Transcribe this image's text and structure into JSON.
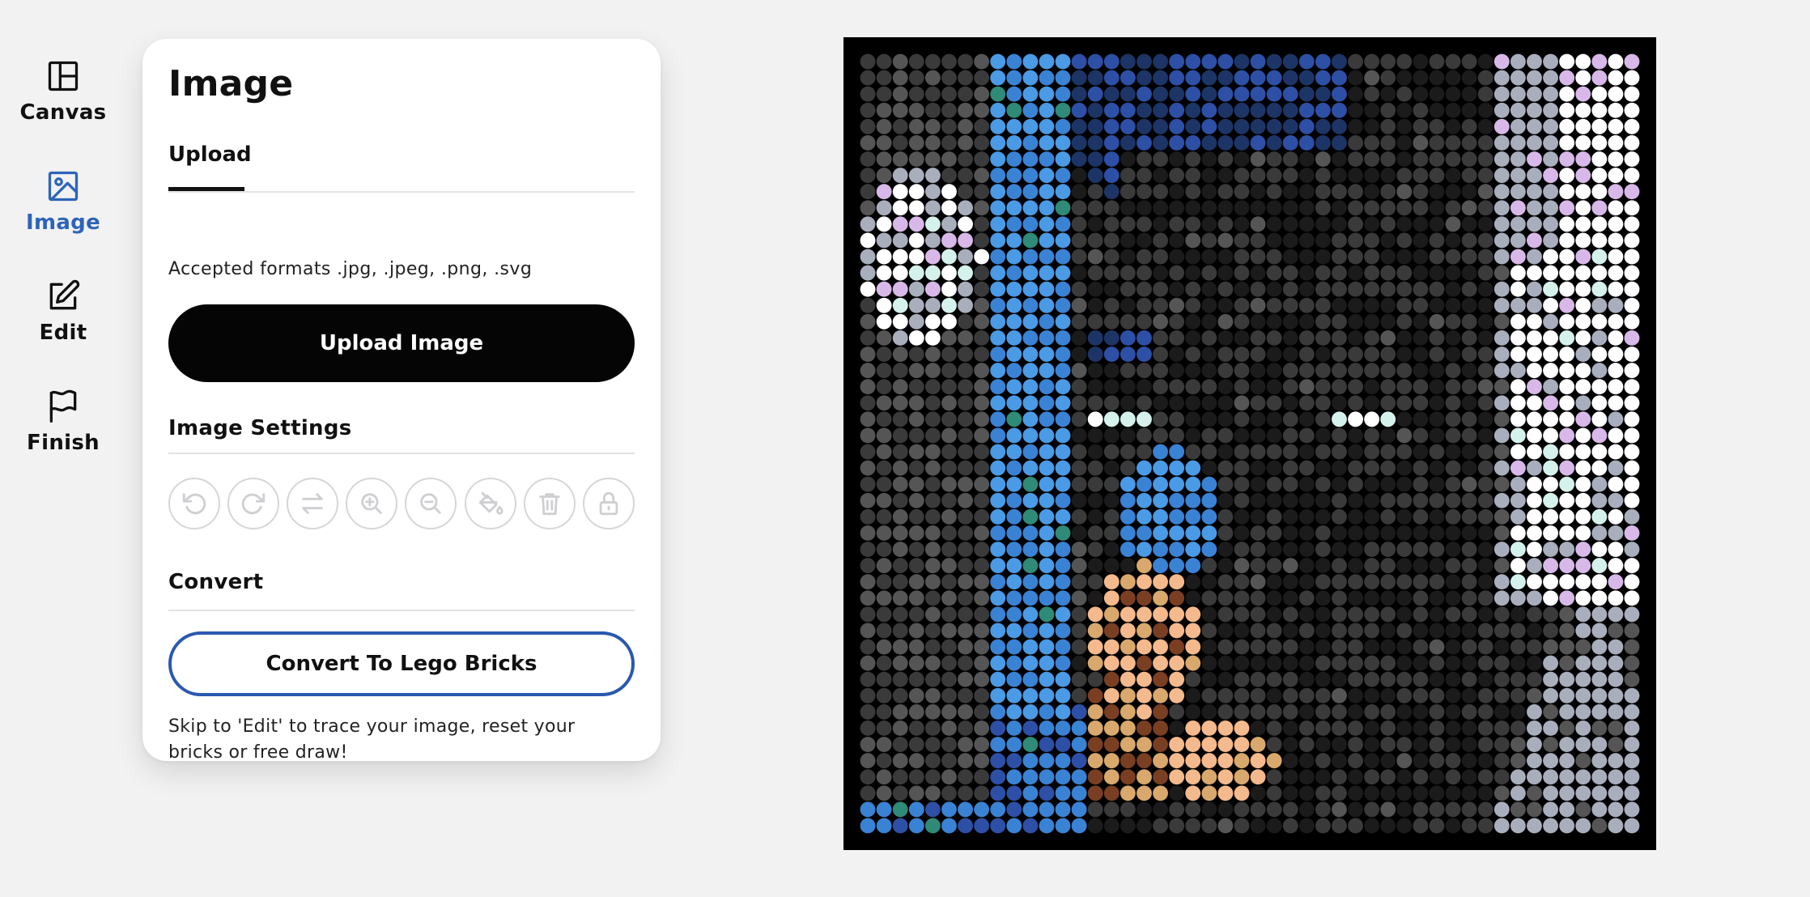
{
  "nav": {
    "items": [
      {
        "label": "Canvas",
        "icon": "layout-icon",
        "active": false
      },
      {
        "label": "Image",
        "icon": "image-icon",
        "active": true
      },
      {
        "label": "Edit",
        "icon": "edit-icon",
        "active": false
      },
      {
        "label": "Finish",
        "icon": "flag-icon",
        "active": false
      }
    ],
    "active_color": "#2e64b8"
  },
  "panel": {
    "title": "Image",
    "tab": "Upload",
    "formats": "Accepted formats .jpg, .jpeg, .png, .svg",
    "upload_button": "Upload Image",
    "settings_title": "Image Settings",
    "tools": [
      {
        "name": "rotate-left-icon"
      },
      {
        "name": "rotate-right-icon"
      },
      {
        "name": "flip-icon"
      },
      {
        "name": "zoom-in-icon"
      },
      {
        "name": "zoom-out-icon"
      },
      {
        "name": "paint-bucket-icon"
      },
      {
        "name": "trash-icon"
      },
      {
        "name": "lock-icon"
      }
    ],
    "convert_title": "Convert",
    "convert_button": "Convert To Lego Bricks",
    "hint": "Skip to 'Edit' to trace your image, reset your bricks or free draw!",
    "convert_border_color": "#2a58b0"
  },
  "canvas": {
    "grid_size": 48,
    "palette": {
      "dark": "#3a3a3a",
      "gray": "#555555",
      "black_stud": "#1b1b1b",
      "blue": "#3a82d4",
      "light_blue": "#4a9ae6",
      "royal_blue": "#2d4fa6",
      "navy": "#1c3566",
      "white": "#ffffff",
      "silver": "#a9aebd",
      "lavender": "#d8b8e8",
      "mint": "#d5f1ec",
      "peach": "#f4b98c",
      "tan": "#d9a86c",
      "brown": "#7a3f22",
      "teal": "#2f8a78",
      "frame": "#000000"
    }
  }
}
